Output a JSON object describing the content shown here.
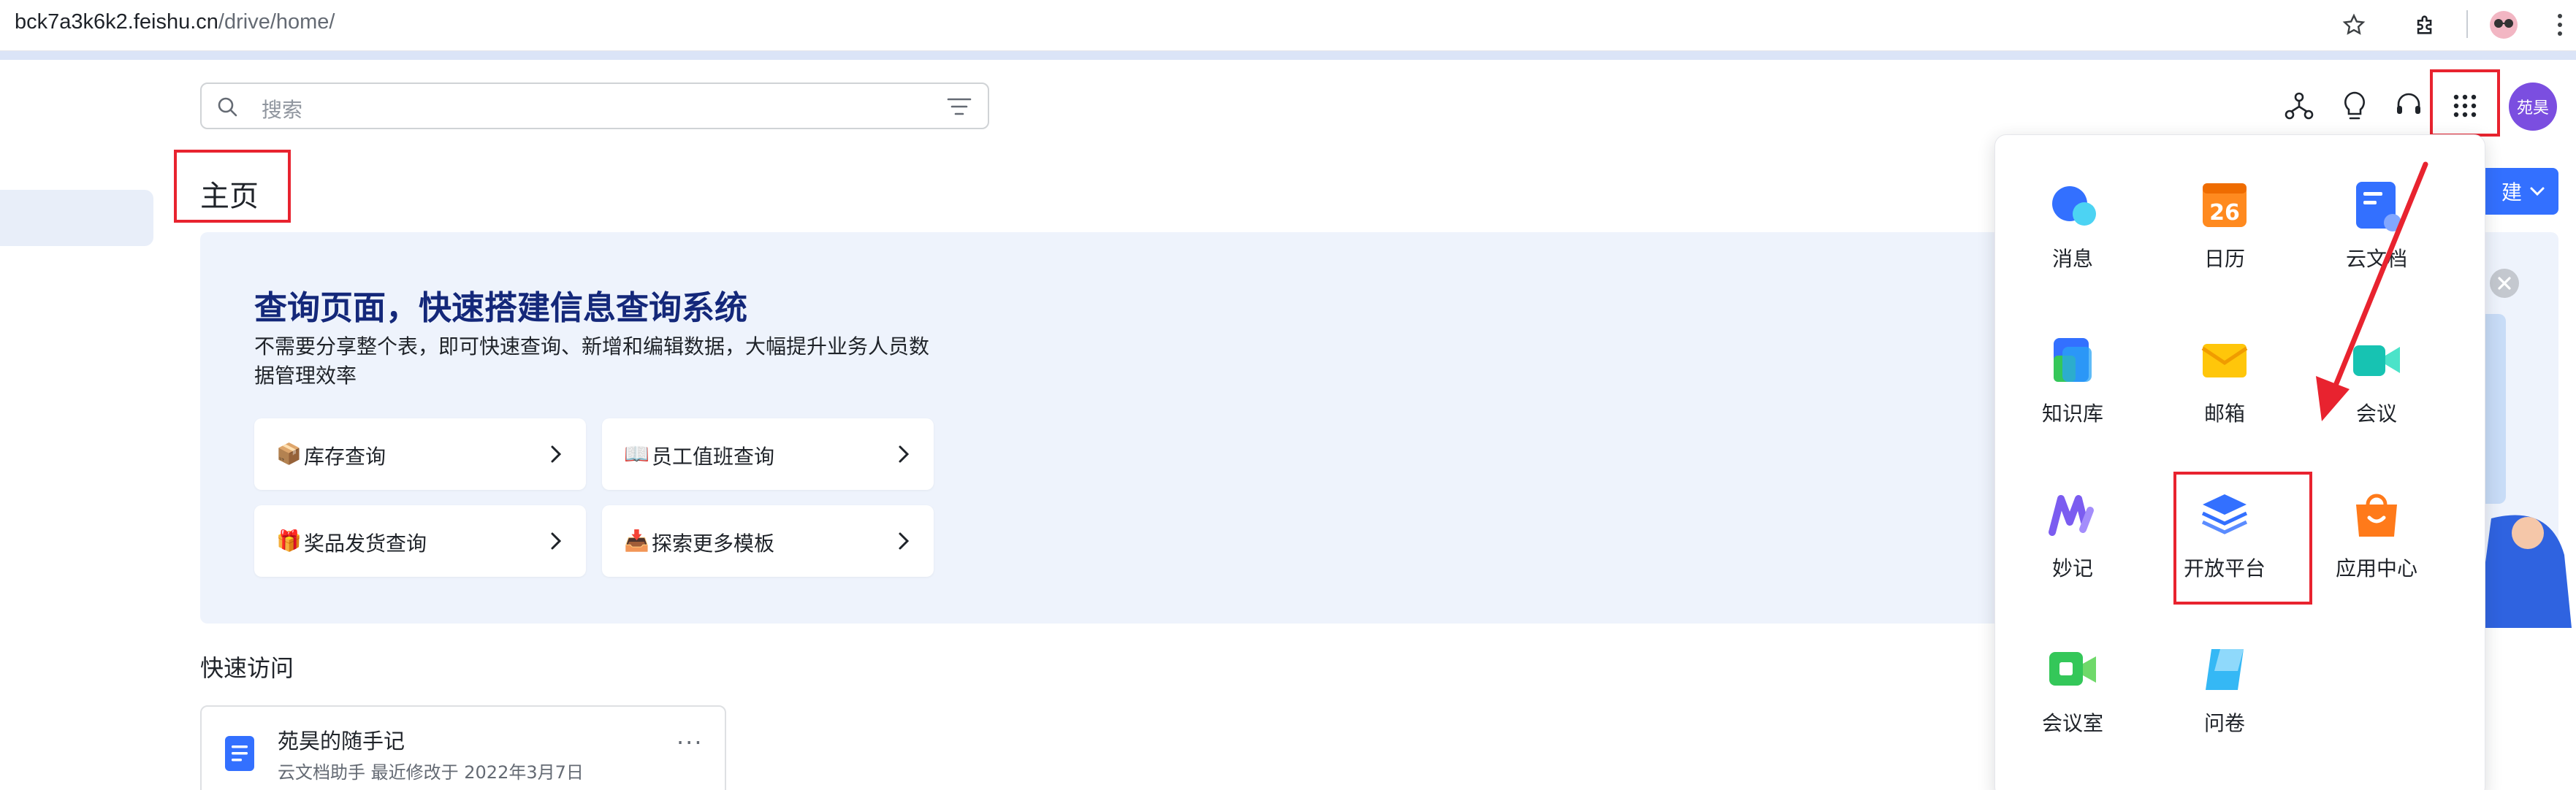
{
  "browser": {
    "url_host": "bck7a3k6k2.feishu.cn",
    "url_path": "/drive/home/"
  },
  "search": {
    "placeholder": "搜索"
  },
  "avatar": {
    "text": "苑昊"
  },
  "page": {
    "title": "主页",
    "new_button_label": "建"
  },
  "banner": {
    "title": "查询页面，快速搭建信息查询系统",
    "description": "不需要分享整个表，即可快速查询、新增和编辑数据，大幅提升业务人员数据管理效率",
    "templates": [
      {
        "emoji": "📦",
        "label": "库存查询"
      },
      {
        "emoji": "📖",
        "label": "员工值班查询"
      },
      {
        "emoji": "🎁",
        "label": "奖品发货查询"
      },
      {
        "emoji": "📥",
        "label": "探索更多模板"
      }
    ]
  },
  "quick_access": {
    "title": "快速访问",
    "items": [
      {
        "name": "苑昊的随手记",
        "meta": "云文档助手 最近修改于 2022年3月7日"
      }
    ]
  },
  "app_panel": {
    "apps": [
      {
        "label": "消息",
        "icon": "message-icon"
      },
      {
        "label": "日历",
        "icon": "calendar-icon",
        "badge": "26"
      },
      {
        "label": "云文档",
        "icon": "cloud-docs-icon"
      },
      {
        "label": "知识库",
        "icon": "wiki-icon"
      },
      {
        "label": "邮箱",
        "icon": "mail-icon"
      },
      {
        "label": "会议",
        "icon": "meeting-icon"
      },
      {
        "label": "妙记",
        "icon": "minutes-icon"
      },
      {
        "label": "开放平台",
        "icon": "open-platform-icon"
      },
      {
        "label": "应用中心",
        "icon": "app-center-icon"
      },
      {
        "label": "会议室",
        "icon": "meeting-room-icon"
      },
      {
        "label": "问卷",
        "icon": "survey-icon"
      }
    ]
  },
  "colors": {
    "accent": "#3370ff",
    "highlight": "#e8232f",
    "banner_bg": "#eef3fc",
    "avatar_bg": "#7b4ee0"
  }
}
